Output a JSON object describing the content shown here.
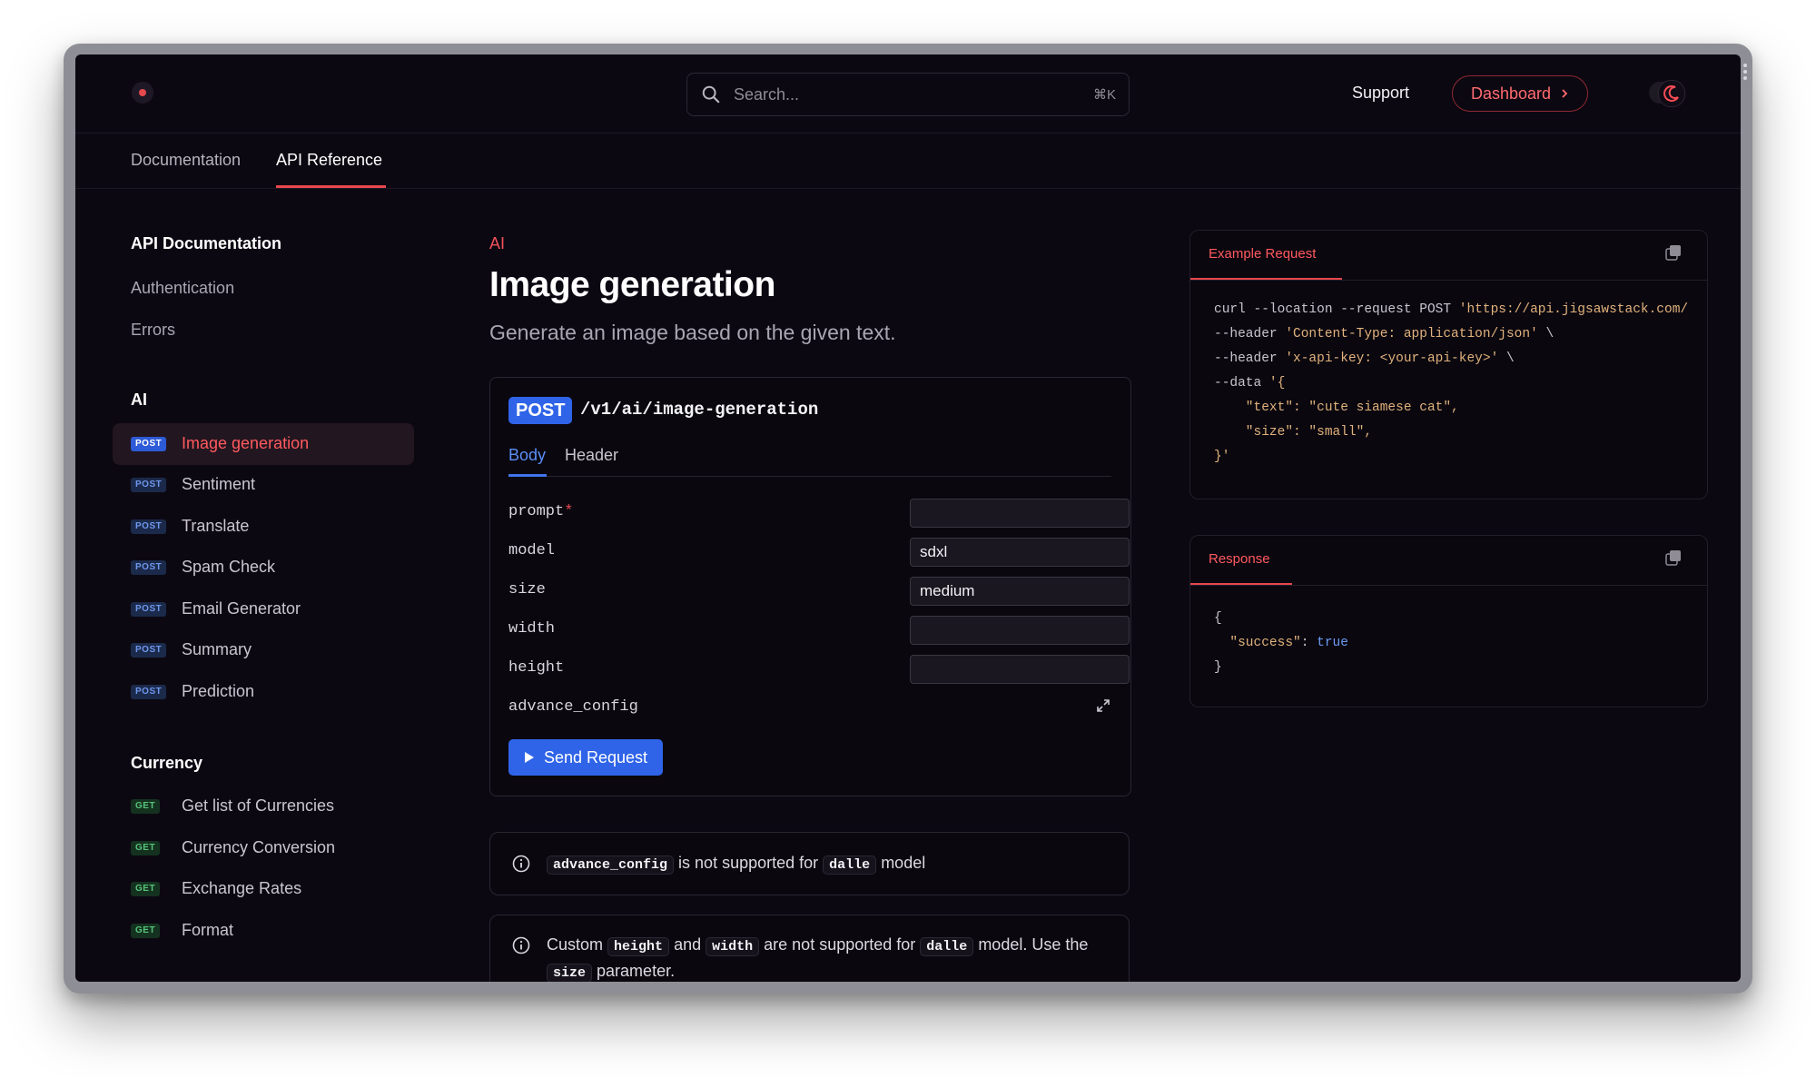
{
  "header": {
    "search_placeholder": "Search...",
    "search_shortcut": "⌘K",
    "support_label": "Support",
    "dashboard_label": "Dashboard"
  },
  "tabs": [
    {
      "label": "Documentation",
      "active": false
    },
    {
      "label": "API Reference",
      "active": true
    }
  ],
  "sidebar": {
    "api_section": {
      "title": "API Documentation",
      "links": [
        "Authentication",
        "Errors"
      ]
    },
    "ai_section": {
      "title": "AI",
      "items": [
        {
          "method": "POST",
          "label": "Image generation",
          "active": true
        },
        {
          "method": "POST",
          "label": "Sentiment"
        },
        {
          "method": "POST",
          "label": "Translate"
        },
        {
          "method": "POST",
          "label": "Spam Check"
        },
        {
          "method": "POST",
          "label": "Email Generator"
        },
        {
          "method": "POST",
          "label": "Summary"
        },
        {
          "method": "POST",
          "label": "Prediction"
        }
      ]
    },
    "currency_section": {
      "title": "Currency",
      "items": [
        {
          "method": "GET",
          "label": "Get list of Currencies"
        },
        {
          "method": "GET",
          "label": "Currency Conversion"
        },
        {
          "method": "GET",
          "label": "Exchange Rates"
        },
        {
          "method": "GET",
          "label": "Format"
        }
      ]
    }
  },
  "main": {
    "breadcrumb": "AI",
    "title": "Image generation",
    "subtitle": "Generate an image based on the given text.",
    "endpoint": {
      "method": "POST",
      "path": "/v1/ai/image-generation",
      "tabs": [
        "Body",
        "Header"
      ],
      "fields": [
        {
          "name": "prompt",
          "required": "*",
          "value": ""
        },
        {
          "name": "model",
          "value": "sdxl"
        },
        {
          "name": "size",
          "value": "medium"
        },
        {
          "name": "width",
          "value": ""
        },
        {
          "name": "height",
          "value": ""
        },
        {
          "name": "advance_config"
        }
      ],
      "send_label": "Send Request"
    },
    "notes": [
      {
        "code1": "advance_config",
        "text1": "is not supported for",
        "code2": "dalle",
        "text2": "model"
      },
      {
        "text0": "Custom",
        "code1": "height",
        "text1": "and",
        "code2": "width",
        "text2": "are not supported for",
        "code3": "dalle",
        "text3": "model. Use the",
        "code4": "size",
        "text4": "parameter."
      }
    ]
  },
  "example_request": {
    "tab_label": "Example Request",
    "lines": [
      {
        "k": "curl --location --request",
        "m": " POST ",
        "s": "'https://api.jigsawstack.com/"
      },
      {
        "k": "--header ",
        "s": "'Content-Type: application/json'",
        "e": " \\"
      },
      {
        "k": "--header ",
        "s": "'x-api-key: <your-api-key>'",
        "e": " \\"
      },
      {
        "k": "--data ",
        "s": "'{"
      },
      {
        "s": "    \"text\": \"cute siamese cat\","
      },
      {
        "s": "    \"size\": \"small\","
      },
      {
        "s": "}'"
      }
    ]
  },
  "response": {
    "tab_label": "Response",
    "open": "{",
    "key": "\"success\"",
    "value": "true",
    "close": "}"
  },
  "colors": {
    "accent_red": "#e5484d",
    "accent_blue": "#2f64e8",
    "background": "#0c0812"
  }
}
